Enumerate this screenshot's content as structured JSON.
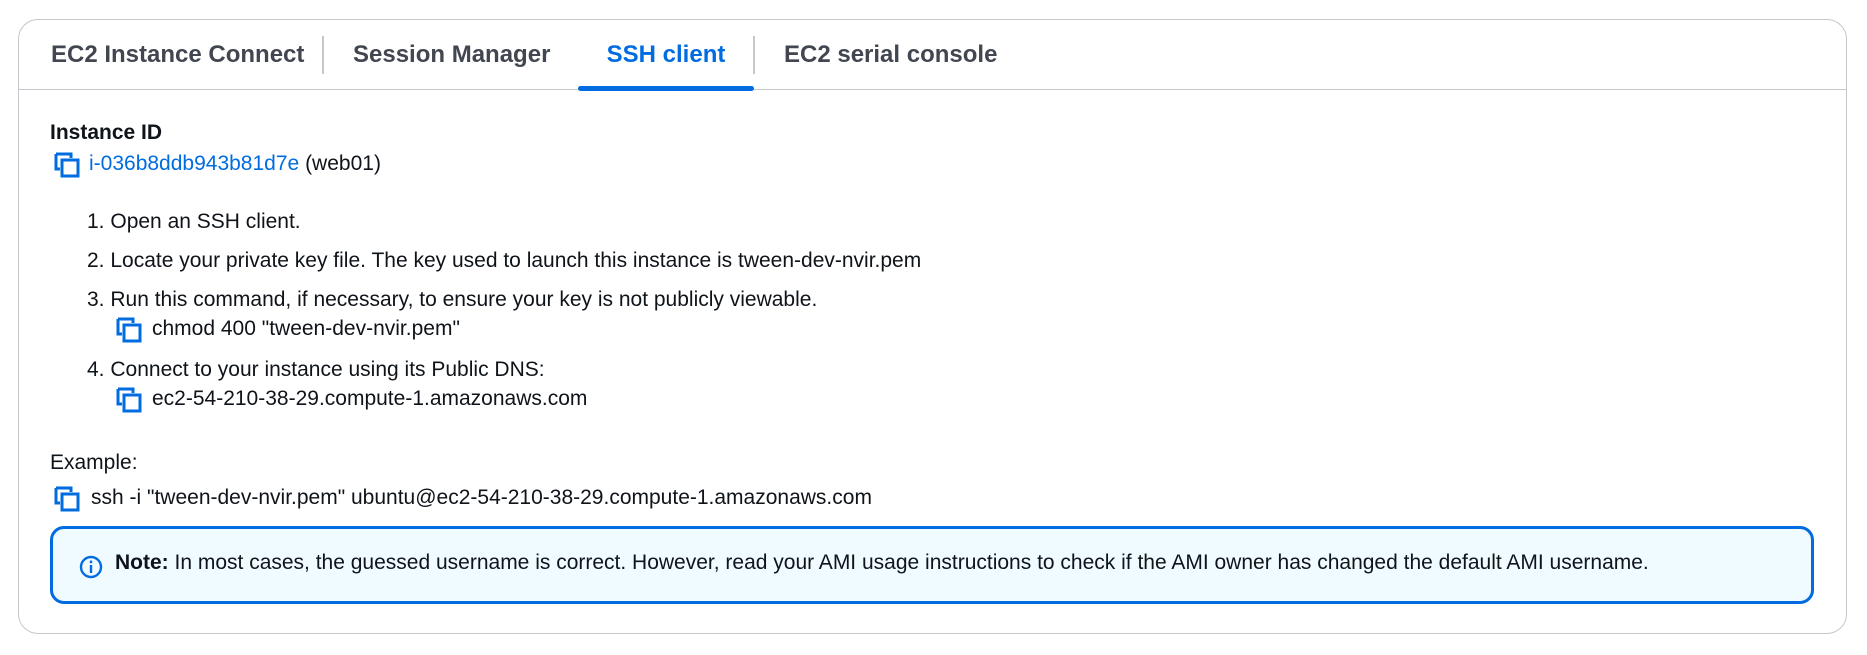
{
  "tabs": [
    {
      "label": "EC2 Instance Connect",
      "active": false
    },
    {
      "label": "Session Manager",
      "active": false
    },
    {
      "label": "SSH client",
      "active": true
    },
    {
      "label": "EC2 serial console",
      "active": false
    }
  ],
  "instance": {
    "heading": "Instance ID",
    "id": "i-036b8ddb943b81d7e",
    "name": "(web01)"
  },
  "steps": [
    {
      "number": "1.",
      "text": "Open an SSH client."
    },
    {
      "number": "2.",
      "text": "Locate your private key file. The key used to launch this instance is tween-dev-nvir.pem"
    },
    {
      "number": "3.",
      "text": "Run this command, if necessary, to ensure your key is not publicly viewable.",
      "command": "chmod 400 \"tween-dev-nvir.pem\""
    },
    {
      "number": "4.",
      "text": "Connect to your instance using its Public DNS:",
      "command": "ec2-54-210-38-29.compute-1.amazonaws.com"
    }
  ],
  "example": {
    "label": "Example:",
    "command": "ssh -i \"tween-dev-nvir.pem\" ubuntu@ec2-54-210-38-29.compute-1.amazonaws.com"
  },
  "note": {
    "bold": "Note:",
    "text": " In most cases, the guessed username is correct. However, read your AMI usage instructions to check if the AMI owner has changed the default AMI username."
  },
  "colors": {
    "accent": "#006ce0",
    "text": "#0f141a",
    "tab_inactive": "#424650",
    "border": "#c6c6cd",
    "note_background": "#f0fbff"
  },
  "icons": {
    "copy": "copy-icon",
    "info": "info-icon"
  }
}
